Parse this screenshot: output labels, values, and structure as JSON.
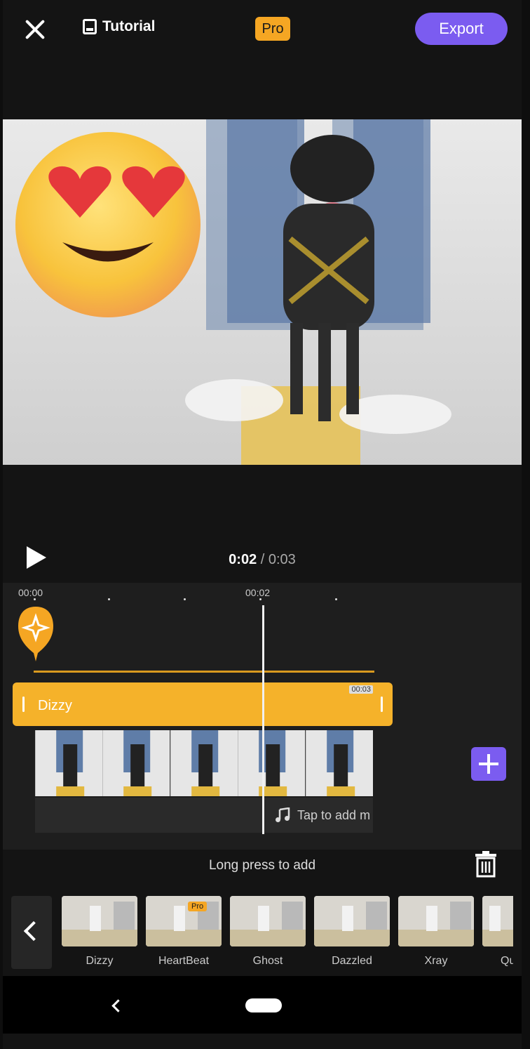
{
  "header": {
    "tutorial_label": "Tutorial",
    "pro_badge": "Pro",
    "export_label": "Export"
  },
  "playback": {
    "current_time": "0:02",
    "separator": " / ",
    "total_time": "0:03"
  },
  "ruler": {
    "labels": [
      "00:00",
      "00:02"
    ]
  },
  "effect_track": {
    "label": "Dizzy",
    "duration_tag": "00:03"
  },
  "audio": {
    "label": "Tap to add m"
  },
  "hint": {
    "text": "Long press to add"
  },
  "effects": [
    {
      "name": "Dizzy"
    },
    {
      "name": "HeartBeat",
      "pro": "Pro"
    },
    {
      "name": "Ghost"
    },
    {
      "name": "Dazzled"
    },
    {
      "name": "Xray"
    },
    {
      "name": "Qu"
    }
  ],
  "colors": {
    "accent": "#7b5cf0",
    "effect": "#f5b22a",
    "pro": "#f5a623"
  }
}
